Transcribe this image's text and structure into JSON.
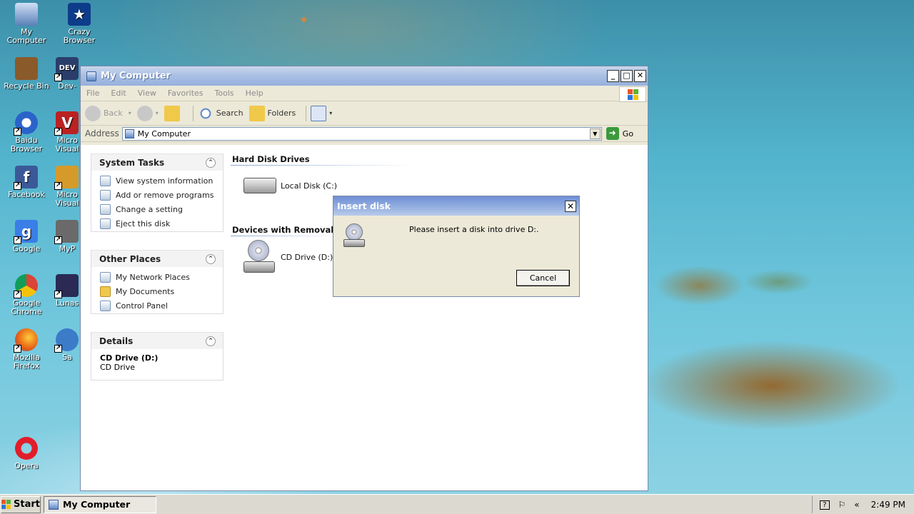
{
  "desktop": {
    "icons": [
      {
        "label": "My Computer"
      },
      {
        "label": "Crazy Browser"
      },
      {
        "label": "Recycle Bin"
      },
      {
        "label": "Dev-"
      },
      {
        "label": "Baidu Browser"
      },
      {
        "label": "Micro Visual"
      },
      {
        "label": "Facebook"
      },
      {
        "label": "Micro Visual"
      },
      {
        "label": "Google"
      },
      {
        "label": "MyP"
      },
      {
        "label": "Google Chrome"
      },
      {
        "label": "Lunas"
      },
      {
        "label": "Mozilla Firefox"
      },
      {
        "label": "Sa"
      },
      {
        "label": "Opera"
      }
    ]
  },
  "window": {
    "title": "My Computer",
    "menu": [
      "File",
      "Edit",
      "View",
      "Favorites",
      "Tools",
      "Help"
    ],
    "toolbar": {
      "back": "Back",
      "search": "Search",
      "folders": "Folders"
    },
    "address": {
      "label": "Address",
      "value": "My Computer",
      "go": "Go"
    },
    "panels": {
      "system_tasks": {
        "title": "System Tasks",
        "items": [
          "View system information",
          "Add or remove programs",
          "Change a setting",
          "Eject this disk"
        ]
      },
      "other_places": {
        "title": "Other Places",
        "items": [
          "My Network Places",
          "My Documents",
          "Control Panel"
        ]
      },
      "details": {
        "title": "Details",
        "name": "CD Drive (D:)",
        "type": "CD Drive"
      }
    },
    "sections": {
      "hard_disks": "Hard Disk Drives",
      "removable": "Devices with Removab",
      "local_disk": "Local Disk (C:)",
      "cd_drive": "CD Drive (D:)"
    }
  },
  "dialog": {
    "title": "Insert disk",
    "message": "Please insert a disk into drive D:.",
    "cancel": "Cancel"
  },
  "taskbar": {
    "start": "Start",
    "task": "My Computer",
    "clock": "2:49 PM"
  }
}
